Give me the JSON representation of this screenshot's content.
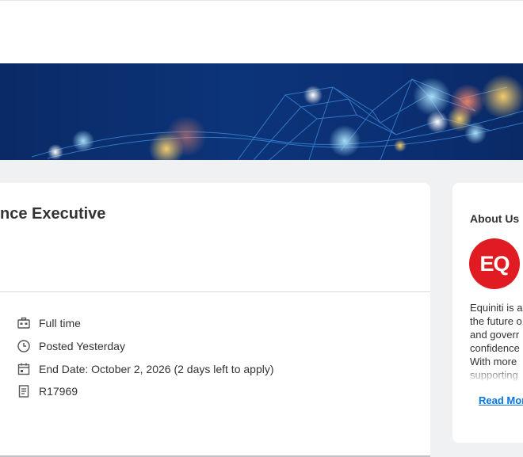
{
  "job": {
    "title": "nce Executive",
    "details": [
      {
        "icon": "briefcase-icon",
        "text": "Full time"
      },
      {
        "icon": "clock-icon",
        "text": "Posted Yesterday"
      },
      {
        "icon": "calendar-icon",
        "text": "End Date: October 2, 2026 (2 days left to apply)"
      },
      {
        "icon": "document-icon",
        "text": "R17969"
      }
    ]
  },
  "about": {
    "title": "About Us",
    "logo_text": "EQ",
    "lines": [
      "Equiniti is a",
      "the future o",
      "and goverr",
      "confidence",
      "With more",
      "supporting"
    ],
    "read_more": "Read Mor"
  },
  "colors": {
    "brand_red": "#e11b22",
    "link_blue": "#0875e1",
    "banner_navy": "#0c3479"
  }
}
